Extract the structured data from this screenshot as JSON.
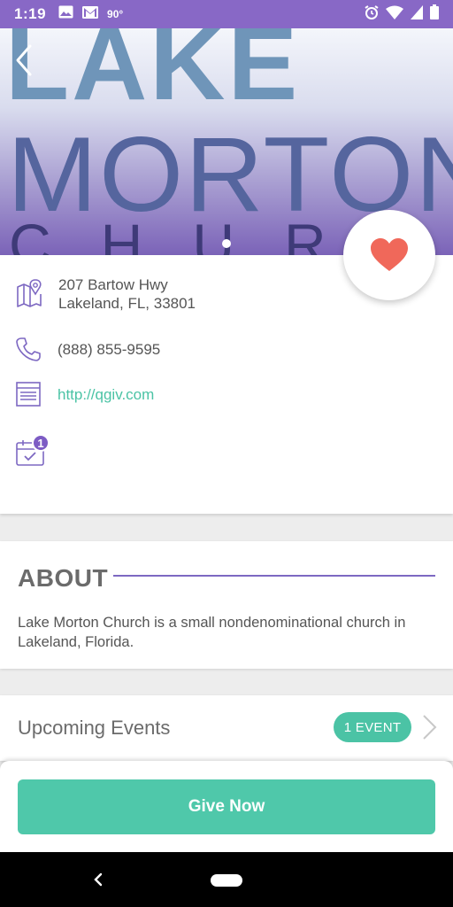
{
  "status_bar": {
    "time": "1:19",
    "temperature": "90°",
    "left_icons": [
      "image-icon",
      "gmail-icon"
    ],
    "right_icons": [
      "alarm-icon",
      "wifi-icon",
      "signal-icon",
      "battery-icon"
    ]
  },
  "hero": {
    "logo_line1": "LAKE",
    "logo_line2": "MORTON",
    "logo_line3": "CHURCH",
    "carousel_pages": 1,
    "active_page": 1
  },
  "info": {
    "address_line1": "207 Bartow Hwy",
    "address_line2": "Lakeland, FL, 33801",
    "phone": "(888) 855-9595",
    "website": "http://qgiv.com",
    "calendar_badge": "1"
  },
  "about": {
    "title": "ABOUT",
    "text": "Lake Morton Church is a small nondenominational church in Lakeland, Florida."
  },
  "events": {
    "label": "Upcoming Events",
    "count_pill": "1 EVENT"
  },
  "give": {
    "label": "Give Now"
  },
  "colors": {
    "status_bar": "#8868c6",
    "accent_green": "#4bc3a5",
    "accent_purple": "#7d5cc4",
    "heart": "#f0685a"
  }
}
